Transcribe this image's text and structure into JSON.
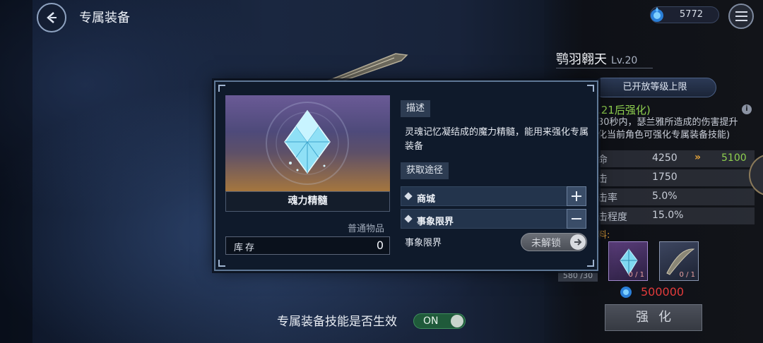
{
  "header": {
    "title": "专属装备",
    "currency_value": "5772"
  },
  "hero": {
    "name": "鹗羽翱天",
    "level": "Lv.20",
    "level_cap_button": "已开放等级上限",
    "enhance_title": ".21后强化)",
    "enhance_desc_line1": "30秒内，瑟兰雅所造成的伤害提升",
    "enhance_desc_line2": "化当前角色可强化专属装备技能)",
    "stats": [
      {
        "label": "命",
        "value": "4250",
        "new_value": "5100"
      },
      {
        "label": "击",
        "value": "1750"
      },
      {
        "label": "击率",
        "value": "5.0%"
      },
      {
        "label": "击程度",
        "value": "15.0%"
      }
    ],
    "materials_label": "料:",
    "materials": [
      {
        "name": "soul-crystal",
        "count": "0 / 1"
      },
      {
        "name": "weapon-blade",
        "count": "0 / 1"
      }
    ],
    "progress": "580 /30",
    "cost": "500000",
    "enhance_button": "强化"
  },
  "skill_toggle": {
    "label": "专属装备技能是否生效",
    "state": "ON"
  },
  "item_dialog": {
    "item_name": "魂力精髓",
    "item_type": "普通物品",
    "stock_label": "库存",
    "stock_value": "0",
    "description_tag": "描述",
    "description": "灵魂记忆凝结成的魔力精髓，能用来强化专属装备",
    "sources_tag": "获取途径",
    "sources": [
      {
        "label": "商城",
        "button": "plus-icon"
      },
      {
        "label": "事象限界",
        "button": "minus-icon"
      }
    ],
    "sub_source_label": "事象限界",
    "locked_button": "未解锁"
  },
  "colors": {
    "accent_green": "#8fd04f",
    "cost_red": "#e23b3b",
    "arrow_orange": "#e2a23a",
    "toggle_green": "#1f5a3a"
  }
}
